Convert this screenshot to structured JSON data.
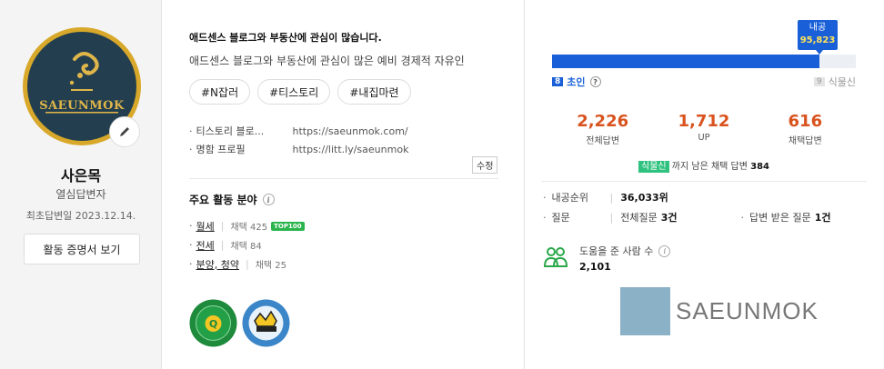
{
  "profile": {
    "avatar_text": "SAEUNMOK",
    "name": "사은목",
    "grade": "열심답변자",
    "first_answer": "최초답변일 2023.12.14.",
    "cert_button": "활동 증명서 보기"
  },
  "intro": {
    "title": "애드센스 블로그와 부동산에 관심이 많습니다.",
    "desc": "애드센스 블로그와 부동산에 관심이 많은 예비 경제적 자유인",
    "tags": [
      "#N잡러",
      "#티스토리",
      "#내집마련"
    ],
    "links": [
      {
        "label": "티스토리 블로...",
        "url": "https://saeunmok.com/"
      },
      {
        "label": "명함 프로필",
        "url": "https://litt.ly/saeunmok"
      }
    ],
    "edit_label": "수정"
  },
  "areas": {
    "title": "주요 활동 분야",
    "items": [
      {
        "name": "월세",
        "count": "채택 425",
        "badge": "TOP100"
      },
      {
        "name": "전세",
        "count": "채택 84",
        "badge": ""
      },
      {
        "name": "분양, 청약",
        "count": "채택 25",
        "badge": ""
      }
    ],
    "badge_icons": [
      "22nd-anniversary-badge",
      "solutionist-badge"
    ]
  },
  "level": {
    "bubble_label": "내공",
    "bubble_value": "95,823",
    "progress_fraction": 0.88,
    "current_num": "8",
    "current_name": "초인",
    "next_num": "9",
    "next_name": "식물신",
    "bar_color": "#1960d8"
  },
  "stats": [
    {
      "value": "2,226",
      "label": "전체답변"
    },
    {
      "value": "1,712",
      "label": "UP"
    },
    {
      "value": "616",
      "label": "채택답변"
    }
  ],
  "remain": {
    "target": "식물신",
    "text": "까지 남은 채택 답변",
    "count": "384"
  },
  "rank": {
    "rank_label": "내공순위",
    "rank_value": "36,033위",
    "q_label": "질문",
    "q_all_label": "전체질문",
    "q_all_value": "3건",
    "q_answered_label": "답변 받은 질문",
    "q_answered_value": "1건"
  },
  "helped": {
    "label": "도움을 준 사람 수",
    "value": "2,101"
  },
  "watermark": {
    "text": "SAEUNMOK"
  }
}
